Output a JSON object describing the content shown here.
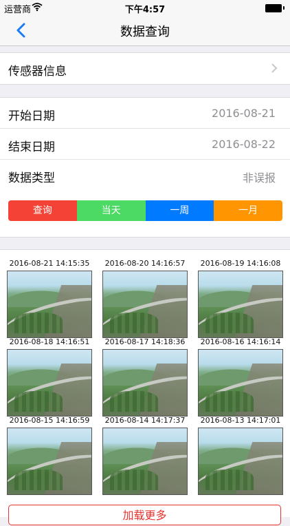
{
  "status_bar": {
    "carrier": "运营商",
    "time": "下午4:57"
  },
  "nav": {
    "title": "数据查询"
  },
  "sensor_row": {
    "label": "传感器信息"
  },
  "query_form": {
    "start_label": "开始日期",
    "start_value": "2016-08-21",
    "end_label": "结束日期",
    "end_value": "2016-08-22",
    "type_label": "数据类型",
    "type_value": "非误报"
  },
  "segments": [
    {
      "label": "查询",
      "color": "#f44336"
    },
    {
      "label": "当天",
      "color": "#4cd964"
    },
    {
      "label": "一周",
      "color": "#007aff"
    },
    {
      "label": "一月",
      "color": "#ff9500"
    }
  ],
  "photos": [
    "2016-08-21 14:15:35",
    "2016-08-20 14:16:57",
    "2016-08-19 14:16:08",
    "2016-08-18 14:16:51",
    "2016-08-17 14:18:36",
    "2016-08-16 14:16:14",
    "2016-08-15 14:16:59",
    "2016-08-14 14:17:37",
    "2016-08-13 14:17:01"
  ],
  "load_more": "加载更多",
  "icons": {
    "back": "chevron-left-icon",
    "wifi": "wifi-icon",
    "battery": "battery-icon",
    "disclosure": "chevron-right-icon"
  },
  "colors": {
    "accent": "#1a7cf2",
    "load_more": "#e8332e"
  }
}
